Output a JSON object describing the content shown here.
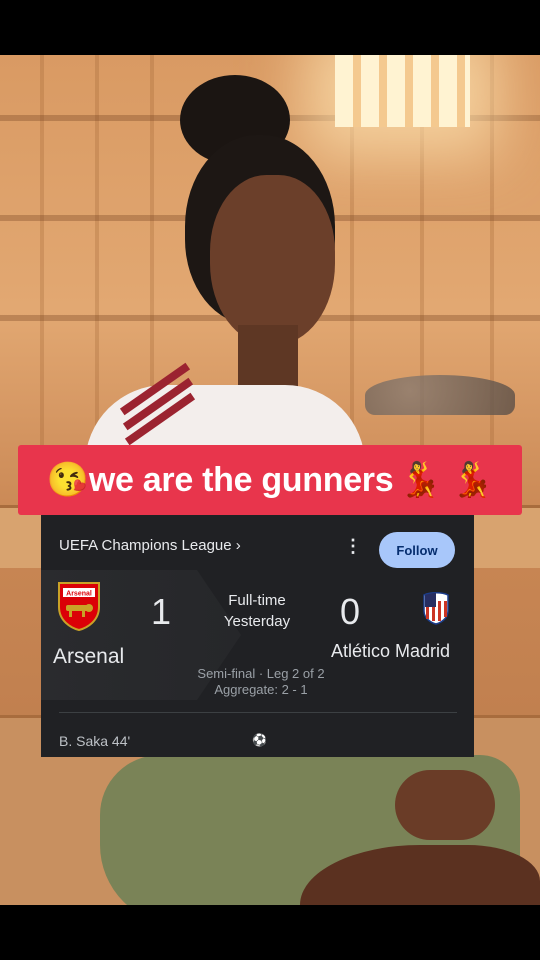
{
  "caption": {
    "emoji_left": "😘",
    "text": "we are the gunners",
    "emoji_right": "💃 💃"
  },
  "match": {
    "league": "UEFA Champions League ›",
    "follow_label": "Follow",
    "more_icon": "⋮",
    "home_team": "Arsenal",
    "away_team": "Atlético Madrid",
    "home_score": "1",
    "away_score": "0",
    "status": "Full-time",
    "date": "Yesterday",
    "stage": "Semi-final · Leg 2 of 2",
    "aggregate": "Aggregate: 2 - 1",
    "scorer": "B. Saka 44'",
    "goal_icon": "soccer-ball-icon",
    "colors": {
      "card_bg": "#202124",
      "follow_bg": "#a8c7fa",
      "caption_bg": "#e8354c"
    }
  }
}
